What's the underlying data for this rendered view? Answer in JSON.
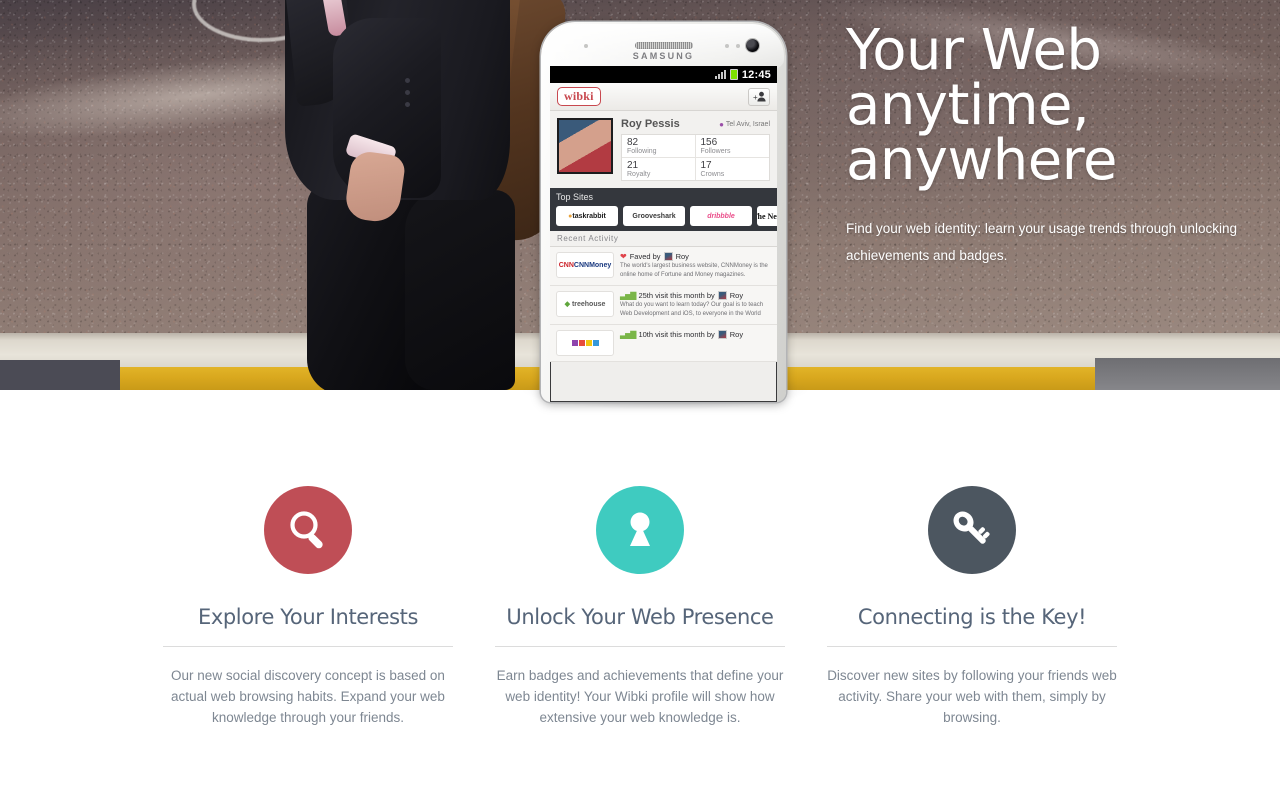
{
  "hero": {
    "title_lines": [
      "Your Web",
      "anytime,",
      "anywhere"
    ],
    "subtitle": "Find your web identity: learn your usage trends through unlocking achievements and badges."
  },
  "phone": {
    "brand": "SAMSUNG",
    "status": {
      "time": "12:45"
    },
    "appbar": {
      "logo": "wibki",
      "add_user_icon": "add-user-icon"
    },
    "profile": {
      "name": "Roy Pessis",
      "location": "Tel Aviv, Israel",
      "stats": [
        {
          "value": "82",
          "label": "Following"
        },
        {
          "value": "156",
          "label": "Followers"
        },
        {
          "value": "21",
          "label": "Royalty"
        },
        {
          "value": "17",
          "label": "Crowns"
        }
      ]
    },
    "top_sites": {
      "title": "Top Sites",
      "tiles": [
        "taskrabbit",
        "Grooveshark",
        "dribbble",
        "The New York Times"
      ]
    },
    "recent_activity": {
      "title": "Recent Activity",
      "items": [
        {
          "logo": "CNNMoney",
          "action": "Faved by",
          "user": "Roy",
          "description": "The world's largest business website, CNNMoney is the online home of Fortune and Money magazines."
        },
        {
          "logo": "treehouse",
          "action": "25th visit this month by",
          "user": "Roy",
          "description": "What do you want to learn today? Our goal is to teach Web Development and iOS, to everyone in the World"
        },
        {
          "logo": "",
          "action": "10th visit this month by",
          "user": "Roy",
          "description": ""
        }
      ]
    }
  },
  "features": [
    {
      "icon": "magnifier-icon",
      "color": "#bf4e56",
      "title": "Explore Your Interests",
      "description": "Our new social discovery concept is based on actual web browsing habits. Expand your web knowledge through your friends."
    },
    {
      "icon": "keyhole-icon",
      "color": "#3fcbc0",
      "title": "Unlock Your Web Presence",
      "description": "Earn badges and achievements that define your web identity! Your Wibki profile will show how extensive your web knowledge is."
    },
    {
      "icon": "key-icon",
      "color": "#4c5660",
      "title": "Connecting is the Key!",
      "description": "Discover new sites by following your friends web activity. Share your web with them, simply by browsing."
    }
  ]
}
